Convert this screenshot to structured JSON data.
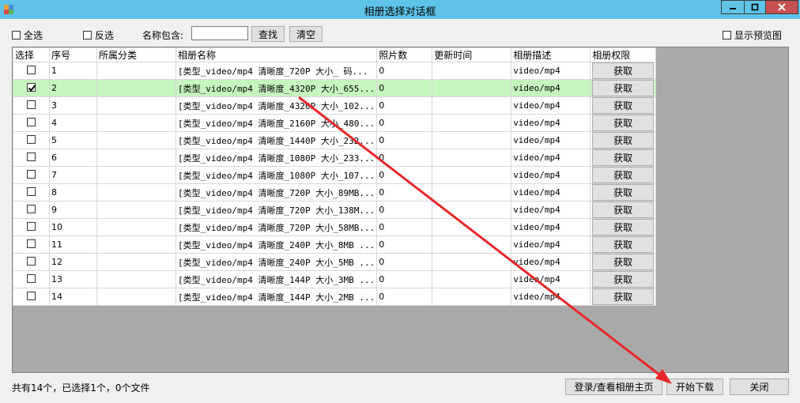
{
  "window": {
    "title": "相册选择对话框"
  },
  "toolbar": {
    "select_all": "全选",
    "invert": "反选",
    "name_contains_label": "名称包含:",
    "search_value": "",
    "find_button": "查找",
    "clear_button": "清空",
    "show_preview": "显示预览图"
  },
  "table": {
    "columns": [
      "选择",
      "序号",
      "所属分类",
      "相册名称",
      "照片数",
      "更新时间",
      "相册描述",
      "相册权限"
    ],
    "rows": [
      {
        "checked": false,
        "index": "1",
        "category": "",
        "name": "[类型_video/mp4 清晰度_720P 大小_ 码...",
        "photos": "0",
        "updated": "",
        "desc": "video/mp4",
        "action": "获取"
      },
      {
        "checked": true,
        "index": "2",
        "category": "",
        "name": "[类型_video/mp4 清晰度_4320P 大小_655...",
        "photos": "0",
        "updated": "",
        "desc": "video/mp4",
        "action": "获取"
      },
      {
        "checked": false,
        "index": "3",
        "category": "",
        "name": "[类型_video/mp4 清晰度_4320P 大小_102...",
        "photos": "0",
        "updated": "",
        "desc": "video/mp4",
        "action": "获取"
      },
      {
        "checked": false,
        "index": "4",
        "category": "",
        "name": "[类型_video/mp4 清晰度_2160P 大小_480...",
        "photos": "0",
        "updated": "",
        "desc": "video/mp4",
        "action": "获取"
      },
      {
        "checked": false,
        "index": "5",
        "category": "",
        "name": "[类型_video/mp4 清晰度_1440P 大小_232...",
        "photos": "0",
        "updated": "",
        "desc": "video/mp4",
        "action": "获取"
      },
      {
        "checked": false,
        "index": "6",
        "category": "",
        "name": "[类型_video/mp4 清晰度_1080P 大小_233...",
        "photos": "0",
        "updated": "",
        "desc": "video/mp4",
        "action": "获取"
      },
      {
        "checked": false,
        "index": "7",
        "category": "",
        "name": "[类型_video/mp4 清晰度_1080P 大小_107...",
        "photos": "0",
        "updated": "",
        "desc": "video/mp4",
        "action": "获取"
      },
      {
        "checked": false,
        "index": "8",
        "category": "",
        "name": "[类型_video/mp4 清晰度_720P 大小_89MB...",
        "photos": "0",
        "updated": "",
        "desc": "video/mp4",
        "action": "获取"
      },
      {
        "checked": false,
        "index": "9",
        "category": "",
        "name": "[类型_video/mp4 清晰度_720P 大小_138M...",
        "photos": "0",
        "updated": "",
        "desc": "video/mp4",
        "action": "获取"
      },
      {
        "checked": false,
        "index": "10",
        "category": "",
        "name": "[类型_video/mp4 清晰度_720P 大小_58MB...",
        "photos": "0",
        "updated": "",
        "desc": "video/mp4",
        "action": "获取"
      },
      {
        "checked": false,
        "index": "11",
        "category": "",
        "name": "[类型_video/mp4 清晰度_240P 大小_8MB ...",
        "photos": "0",
        "updated": "",
        "desc": "video/mp4",
        "action": "获取"
      },
      {
        "checked": false,
        "index": "12",
        "category": "",
        "name": "[类型_video/mp4 清晰度_240P 大小_5MB ...",
        "photos": "0",
        "updated": "",
        "desc": "video/mp4",
        "action": "获取"
      },
      {
        "checked": false,
        "index": "13",
        "category": "",
        "name": "[类型_video/mp4 清晰度_144P 大小_3MB ...",
        "photos": "0",
        "updated": "",
        "desc": "video/mp4",
        "action": "获取"
      },
      {
        "checked": false,
        "index": "14",
        "category": "",
        "name": "[类型_video/mp4 清晰度_144P 大小_2MB ...",
        "photos": "0",
        "updated": "",
        "desc": "video/mp4",
        "action": "获取"
      }
    ]
  },
  "footer": {
    "status": "共有14个，已选择1个，0个文件",
    "login_button": "登录/查看相册主页",
    "download_button": "开始下载",
    "close_button": "关闭"
  },
  "colors": {
    "titlebar": "#5fc3e8",
    "selected_row": "#c7f5c0",
    "annotation_arrow": "#e8262a"
  }
}
